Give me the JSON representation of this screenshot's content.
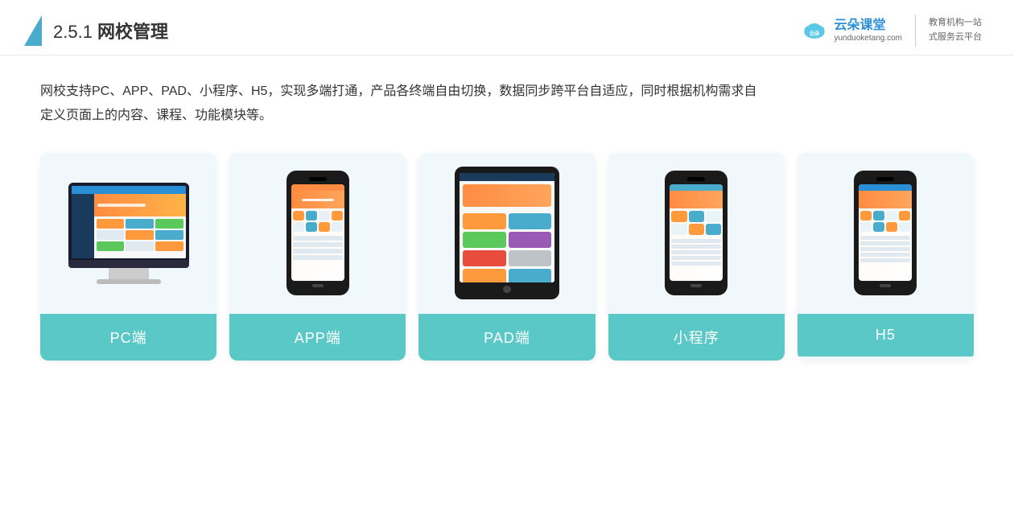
{
  "header": {
    "section_number": "2.5.1",
    "title_plain": "",
    "title_bold": "网校管理",
    "brand": {
      "name": "云朵课堂",
      "url": "yunduoketang.com",
      "slogan_line1": "教育机构一站",
      "slogan_line2": "式服务云平台"
    }
  },
  "description": {
    "text": "网校支持PC、APP、PAD、小程序、H5，实现多端打通，产品各终端自由切换，数据同步跨平台自适应，同时根据机构需求自定义页面上的内容、课程、功能模块等。"
  },
  "cards": [
    {
      "id": "pc",
      "label": "PC端"
    },
    {
      "id": "app",
      "label": "APP端"
    },
    {
      "id": "pad",
      "label": "PAD端"
    },
    {
      "id": "miniprogram",
      "label": "小程序"
    },
    {
      "id": "h5",
      "label": "H5"
    }
  ]
}
